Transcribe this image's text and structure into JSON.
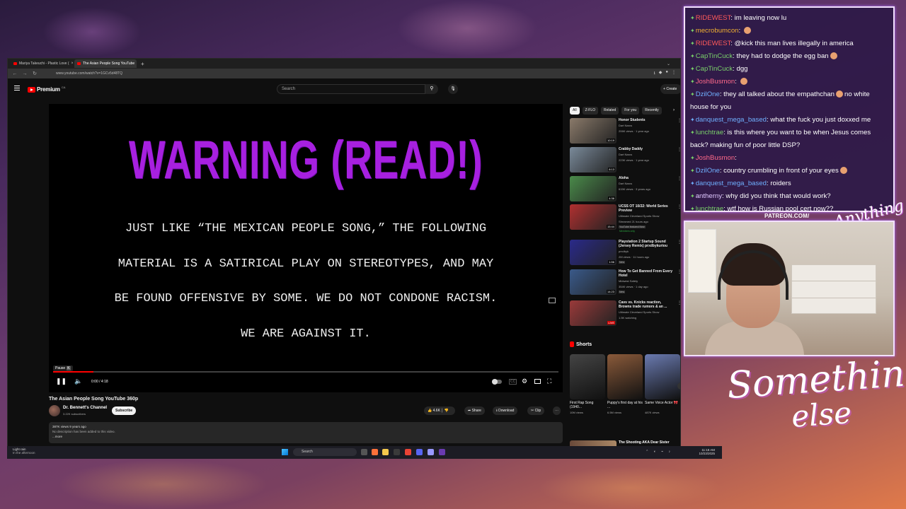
{
  "browser": {
    "tabs": [
      {
        "label": "Mariya Takeuchi - Plastic Love (",
        "active": false
      },
      {
        "label": "The Asian People Song YouTube",
        "active": true
      }
    ],
    "url": "www.youtube.com/watch?v=1GCv5d48TQ"
  },
  "youtube": {
    "brand": "Premium",
    "brand_sup": "CA",
    "search_placeholder": "Search",
    "create_label": "Create"
  },
  "player": {
    "title_text": "WARNING (READ!)",
    "body_lines": [
      "JUST LIKE “THE MEXICAN PEOPLE SONG,” THE FOLLOWING",
      "MATERIAL IS A SATIRICAL PLAY ON STEREOTYPES, AND MAY",
      "BE FOUND OFFENSIVE BY SOME. WE DO NOT CONDONE RACISM.",
      "WE ARE AGAINST IT."
    ],
    "pause_tip": "Pause",
    "pause_key": "K",
    "time": "0:00 / 4:18",
    "progress_fraction": 0.08
  },
  "video": {
    "title": "The Asian People Song YouTube 360p",
    "channel": "Dr. Bennett's Channel",
    "subscribers": "3.22K subscribers",
    "subscribe_label": "Subscribe",
    "likes": "4.6K",
    "share_label": "Share",
    "download_label": "Download",
    "clip_label": "Clip",
    "views_age": "387K views  9 years ago",
    "description": "No description has been added to this video.",
    "more_label": "...more"
  },
  "sidebar": {
    "chips": [
      {
        "label": "All",
        "active": true
      },
      {
        "label": "Z-FLO",
        "active": false
      },
      {
        "label": "Related",
        "active": false
      },
      {
        "label": "For you",
        "active": false
      },
      {
        "label": "Recently",
        "active": false
      }
    ],
    "recommendations": [
      {
        "title": "Honor Students",
        "channel": "Dart Narcs",
        "stats": "206K views · 1 year ago",
        "duration": "10:19",
        "thumb": "#8a7a6a"
      },
      {
        "title": "Crabby Daddy",
        "channel": "Dart Narcs",
        "stats": "223K views · 1 year ago",
        "duration": "8:13",
        "thumb": "#7a8a9a"
      },
      {
        "title": "Aloha",
        "channel": "Dart Narcs",
        "stats": "615K views · 3 years ago",
        "duration": "4:36",
        "thumb": "#4a8a4a"
      },
      {
        "title": "UCSS OT 10/22: World Series Preview",
        "channel": "Ultimate Cleveland Sports Show",
        "stats": "Streamed 21 hours ago",
        "duration": "15:44",
        "badge": "YouTube featured  New",
        "badge2": "Members only",
        "thumb": "#b03030"
      },
      {
        "title": "Playstation 2 Startup Sound (Jersey Remix) prxdbykuriou",
        "channel": "prxdbyk",
        "stats": "2M views · 11 hours ago",
        "duration": "1:56",
        "badge": "New",
        "thumb": "#2a2a8a"
      },
      {
        "title": "How To Get Banned From Every Hotel",
        "channel": "Midwest Safety",
        "stats": "354K views · 1 day ago",
        "duration": "14:23",
        "badge": "New",
        "thumb": "#3a5a8a"
      },
      {
        "title": "Cavs vs. Knicks reaction, Browns trade rumors & an ...",
        "channel": "Ultimate Cleveland Sports Show",
        "stats": "1.5K watching",
        "duration": "LIVE",
        "thumb": "#9a3a3a"
      }
    ],
    "shorts_label": "Shorts",
    "shorts": [
      {
        "title": "First Rap Song (1940...",
        "views": "10M views",
        "thumb": "#444"
      },
      {
        "title": "Puppy's first day at his ...",
        "views": "6.5M views",
        "thumb": "#8a5a3a"
      },
      {
        "title": "Same Voice Actor 🎀",
        "views": "487K views",
        "thumb": "#6a7ab0"
      }
    ],
    "last_rec_title": "The Shooting AKA Dear Sister"
  },
  "taskbar": {
    "weather_line1": "Light rain",
    "weather_line2": "In the afternoon",
    "search_label": "Search",
    "time": "11:18 AM",
    "date": "10/23/2025"
  },
  "chat": [
    {
      "user": "RIDEWEST",
      "color": "#ff5a5a",
      "text": "im leaving now lu",
      "star": "green"
    },
    {
      "user": "mecrobumcon",
      "color": "#f0b030",
      "text": "",
      "emote": true,
      "star": "green"
    },
    {
      "user": "RIDEWEST",
      "color": "#ff5a5a",
      "text": "@kick this man lives illegally in america",
      "star": "green"
    },
    {
      "user": "CapTinCuck",
      "color": "#7ad06a",
      "text": "they had to dodge the egg ban",
      "emote": true,
      "star": "green"
    },
    {
      "user": "CapTinCuck",
      "color": "#7ad06a",
      "text": "dgg",
      "star": "green"
    },
    {
      "user": "JoshBusmon",
      "color": "#ff6a8a",
      "text": "",
      "emote": true,
      "star": "green"
    },
    {
      "user": "DzilOne",
      "color": "#6fb0ff",
      "text": "they all talked about the empathchan",
      "emote": true,
      "text2": "no white house for you",
      "star": "green"
    },
    {
      "user": "danquest_mega_based",
      "color": "#6fb0ff",
      "text": "what the fuck you just doxxed me",
      "star": "blue"
    },
    {
      "user": "lunchtrae",
      "color": "#7ad06a",
      "text": "is this where you want to be when Jesus comes back? making fun of poor little DSP?",
      "star": "green"
    },
    {
      "user": "JoshBusmon",
      "color": "#ff6a8a",
      "text": "",
      "star": "green"
    },
    {
      "user": "DzilOne",
      "color": "#6fb0ff",
      "text": "country crumbling in front of your eyes",
      "emote": true,
      "star": "green"
    },
    {
      "user": "danquest_mega_based",
      "color": "#6fb0ff",
      "text": "roiders",
      "star": "blue"
    },
    {
      "user": "antherny",
      "color": "#e0c8ff",
      "text": "why did you think that would work?",
      "star": "green"
    },
    {
      "user": "lunchtrae",
      "color": "#7ad06a",
      "text": "wtf how is Russian pool cert now??",
      "star": "green"
    }
  ],
  "overlay": {
    "patreon": "PATREON.COM/",
    "patreon_script": "Anything Else",
    "brand_line1": "Something",
    "brand_line2": "else"
  },
  "colors": {
    "warning_purple": "#a720e0",
    "frame_glow": "#f3e0ff",
    "yt_red": "#ff0000"
  }
}
